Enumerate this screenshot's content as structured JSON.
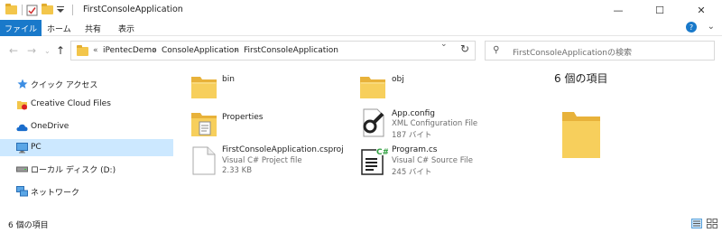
{
  "window": {
    "title": "FirstConsoleApplication",
    "minimize": "—",
    "maximize": "☐",
    "close": "✕"
  },
  "ribbon": {
    "file_tab": "ファイル",
    "tabs": [
      "ホーム",
      "共有",
      "表示"
    ],
    "expand": "⌄",
    "help": "?"
  },
  "address": {
    "prefix": "«",
    "crumbs": [
      "iPentecDemo",
      "ConsoleApplication",
      "FirstConsoleApplication"
    ],
    "separator": "›",
    "dropdown": "⌄",
    "refresh": "↻"
  },
  "search": {
    "placeholder": "FirstConsoleApplicationの検索"
  },
  "navpane": {
    "items": [
      {
        "label": "クイック アクセス",
        "icon": "star-icon"
      },
      {
        "label": "Creative Cloud Files",
        "icon": "creative-cloud-icon"
      },
      {
        "label": "OneDrive",
        "icon": "cloud-icon"
      },
      {
        "label": "PC",
        "icon": "monitor-icon",
        "selected": true
      },
      {
        "label": "ローカル ディスク (D:)",
        "icon": "drive-icon"
      },
      {
        "label": "ネットワーク",
        "icon": "network-icon"
      }
    ]
  },
  "files": [
    {
      "name": "bin",
      "icon": "folder-icon"
    },
    {
      "name": "obj",
      "icon": "folder-icon"
    },
    {
      "name": "Properties",
      "icon": "properties-folder-icon"
    },
    {
      "name": "App.config",
      "type": "XML Configuration File",
      "size": "187 バイト",
      "icon": "config-file-icon"
    },
    {
      "name": "FirstConsoleApplication.csproj",
      "type": "Visual C# Project file",
      "size": "2.33 KB",
      "icon": "blank-file-icon"
    },
    {
      "name": "Program.cs",
      "type": "Visual C# Source File",
      "size": "245 バイト",
      "icon": "csharp-file-icon"
    }
  ],
  "preview": {
    "title": "6 個の項目"
  },
  "status": {
    "text": "6 個の項目"
  },
  "colors": {
    "accent": "#1979ca",
    "selected": "#cce8ff",
    "folder": "#f3c64b"
  }
}
